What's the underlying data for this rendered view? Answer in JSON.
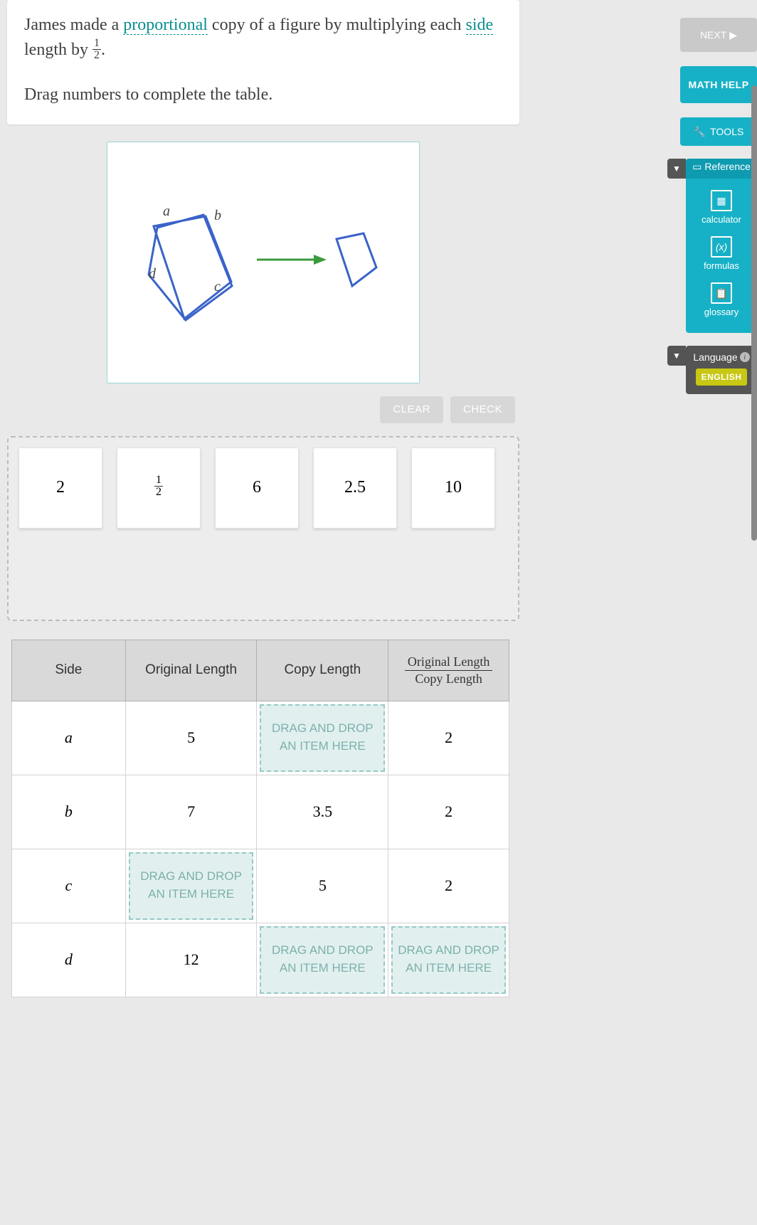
{
  "question": {
    "text1a": "James made a ",
    "vocab1": "proportional",
    "text1b": " copy of a figure by multiplying each ",
    "vocab2": "side",
    "text1c": " length by ",
    "fraction": {
      "num": "1",
      "den": "2"
    },
    "text1d": ".",
    "text2": "Drag numbers to complete the table."
  },
  "figure": {
    "labels": {
      "a": "a",
      "b": "b",
      "c": "c",
      "d": "d"
    }
  },
  "buttons": {
    "clear": "CLEAR",
    "check": "CHECK",
    "next": "NEXT",
    "math_help": "MATH HELP",
    "tools": "TOOLS"
  },
  "tiles": [
    "2",
    "1/2",
    "6",
    "2.5",
    "10"
  ],
  "table": {
    "headers": {
      "side": "Side",
      "orig": "Original Length",
      "copy": "Copy Length",
      "ratio_n": "Original Length",
      "ratio_d": "Copy Length"
    },
    "drop_text": "DRAG AND DROP\nAN ITEM HERE",
    "rows": [
      {
        "side": "a",
        "orig": "5",
        "copy": null,
        "ratio": "2"
      },
      {
        "side": "b",
        "orig": "7",
        "copy": "3.5",
        "ratio": "2"
      },
      {
        "side": "c",
        "orig": null,
        "copy": "5",
        "ratio": "2"
      },
      {
        "side": "d",
        "orig": "12",
        "copy": null,
        "ratio": null
      }
    ]
  },
  "reference": {
    "title": "Reference",
    "items": [
      "calculator",
      "formulas",
      "glossary"
    ]
  },
  "language": {
    "title": "Language",
    "selected": "ENGLISH"
  }
}
